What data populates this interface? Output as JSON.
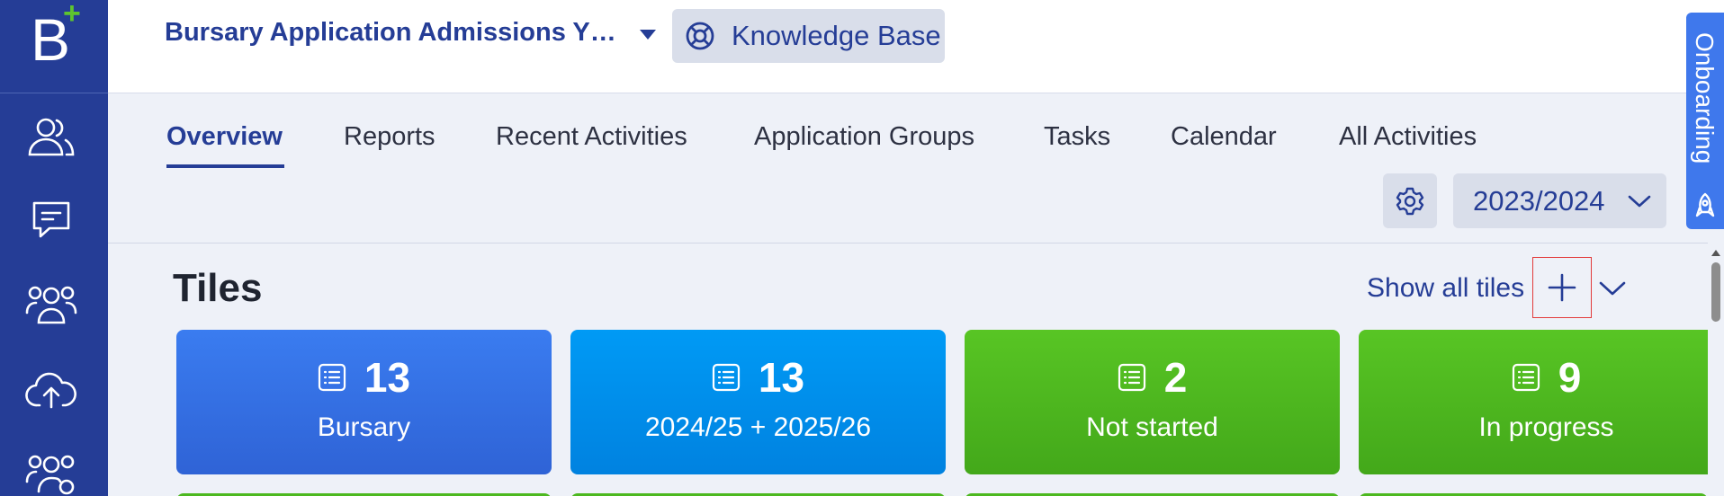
{
  "app": {
    "logo_letter": "B",
    "logo_plus": "+",
    "title": "Bursary Application Admissions Y…",
    "knowledge_base_label": "Knowledge Base",
    "onboarding_label": "Onboarding"
  },
  "sidebar": {
    "items": [
      {
        "icon": "users-icon"
      },
      {
        "icon": "message-icon"
      },
      {
        "icon": "group-icon"
      },
      {
        "icon": "cloud-upload-icon"
      },
      {
        "icon": "group-settings-icon"
      }
    ]
  },
  "tabs": [
    {
      "label": "Overview",
      "active": true
    },
    {
      "label": "Reports"
    },
    {
      "label": "Recent Activities"
    },
    {
      "label": "Application Groups"
    },
    {
      "label": "Tasks"
    },
    {
      "label": "Calendar"
    },
    {
      "label": "All Activities"
    }
  ],
  "year_selector": {
    "value": "2023/2024"
  },
  "tiles_section": {
    "heading": "Tiles",
    "show_all_label": "Show all tiles"
  },
  "tiles": [
    {
      "count": "13",
      "label": "Bursary",
      "color": "#3a7cf0"
    },
    {
      "count": "13",
      "label": "2024/25 + 2025/26",
      "color": "#009af5"
    },
    {
      "count": "2",
      "label": "Not started",
      "color": "#58c524"
    },
    {
      "count": "9",
      "label": "In progress",
      "color": "#58c524"
    }
  ],
  "colors": {
    "sidebar": "#253d96",
    "accent": "#253d96",
    "logo_plus": "#5ec52e",
    "onboarding": "#3f78ec"
  }
}
